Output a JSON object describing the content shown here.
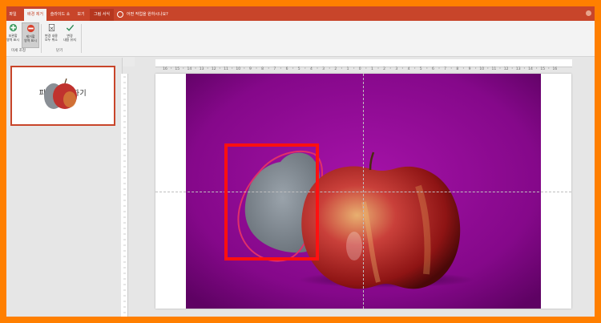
{
  "ribbon_tabs": [
    {
      "label": "파일",
      "active": false
    },
    {
      "label": "배경 제거",
      "active": true
    },
    {
      "label": "슬라이드 쇼",
      "active": false
    },
    {
      "label": "보기",
      "active": false
    },
    {
      "label": "그림 서식",
      "active": false
    }
  ],
  "tell_me": "어떤 작업을 원하시나요?",
  "ribbon": {
    "mark_keep_line1": "보관할",
    "mark_keep_line2": "영역 표시",
    "mark_remove_line1": "제거할",
    "mark_remove_line2": "영역 표시",
    "refine_group_label": "미세 조정",
    "discard_line1": "변경 내용",
    "discard_line2": "모두 취소",
    "keep_changes_line1": "변경",
    "keep_changes_line2": "내용 유지",
    "close_group_label": "닫기"
  },
  "thumbnail": {
    "title": "피워  제거 하기"
  },
  "ruler_labels": [
    "16",
    "15",
    "14",
    "13",
    "12",
    "11",
    "10",
    "9",
    "8",
    "7",
    "6",
    "5",
    "4",
    "3",
    "2",
    "1",
    "0",
    "1",
    "2",
    "3",
    "4",
    "5",
    "6",
    "7",
    "8",
    "9",
    "10",
    "11",
    "12",
    "13",
    "14",
    "15",
    "16"
  ],
  "colors": {
    "accent": "#c8452a",
    "frame": "#ff7f00",
    "photo_background": "#8b0f8f",
    "highlight": "#ff1010"
  }
}
